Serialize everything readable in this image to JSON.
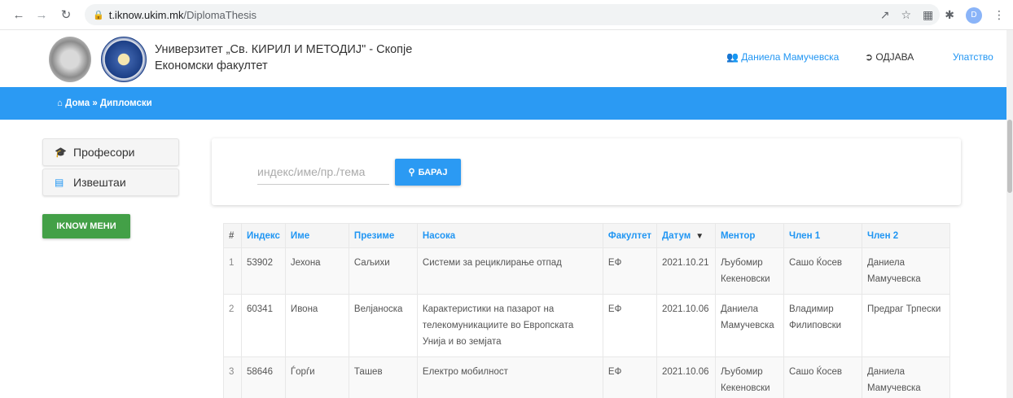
{
  "browser": {
    "url_host": "t.iknow.ukim.mk",
    "url_path": "/DiplomaThesis",
    "profile_initial": "D"
  },
  "header": {
    "university": "Универзитет „Св. КИРИЛ И МЕТОДИЈ\" - Скопје",
    "faculty": "Економски факултет",
    "user_name": "Даниела Мамучевска",
    "logout_label": "ОДЈАВА",
    "help_label": "Упатство"
  },
  "breadcrumb": {
    "home": "Дома",
    "current": "Дипломски"
  },
  "sidebar": {
    "items": [
      {
        "label": "Професори",
        "icon": "graduation-cap-icon"
      },
      {
        "label": "Извештаи",
        "icon": "bar-chart-icon"
      }
    ],
    "iknow_button": "IKNOW МЕНИ"
  },
  "search": {
    "placeholder": "индекс/име/пр./тема",
    "value": "",
    "button_label": "БАРАЈ"
  },
  "table": {
    "headers": [
      "#",
      "Индекс",
      "Име",
      "Презиме",
      "Насока",
      "Факултет",
      "Датум",
      "Ментор",
      "Член 1",
      "Член 2"
    ],
    "rows": [
      {
        "num": "1",
        "index": "53902",
        "first": "Јехона",
        "last": "Сaљихи",
        "topic": "Системи за рециклирање отпад",
        "faculty": "ЕФ",
        "date": "2021.10.21",
        "mentor": "Љубомир Кекеновски",
        "member1": "Сашо Ќосев",
        "member2": "Даниела Мамучевска"
      },
      {
        "num": "2",
        "index": "60341",
        "first": "Ивона",
        "last": "Велјаноска",
        "topic": "Карактеристики на пазарот на телекомуникациите во Европската Унија и во земјата",
        "faculty": "ЕФ",
        "date": "2021.10.06",
        "mentor": "Даниела Мамучевска",
        "member1": "Владимир Филиповски",
        "member2": "Предраг Трпески"
      },
      {
        "num": "3",
        "index": "58646",
        "first": "Ѓорѓи",
        "last": "Ташев",
        "topic": "Електро мобилност",
        "faculty": "ЕФ",
        "date": "2021.10.06",
        "mentor": "Љубомир Кекеновски",
        "member1": "Сашо Ќосев",
        "member2": "Даниела Мамучевска"
      }
    ]
  },
  "colors": {
    "primary_blue": "#2b9af3",
    "green": "#43a047"
  }
}
